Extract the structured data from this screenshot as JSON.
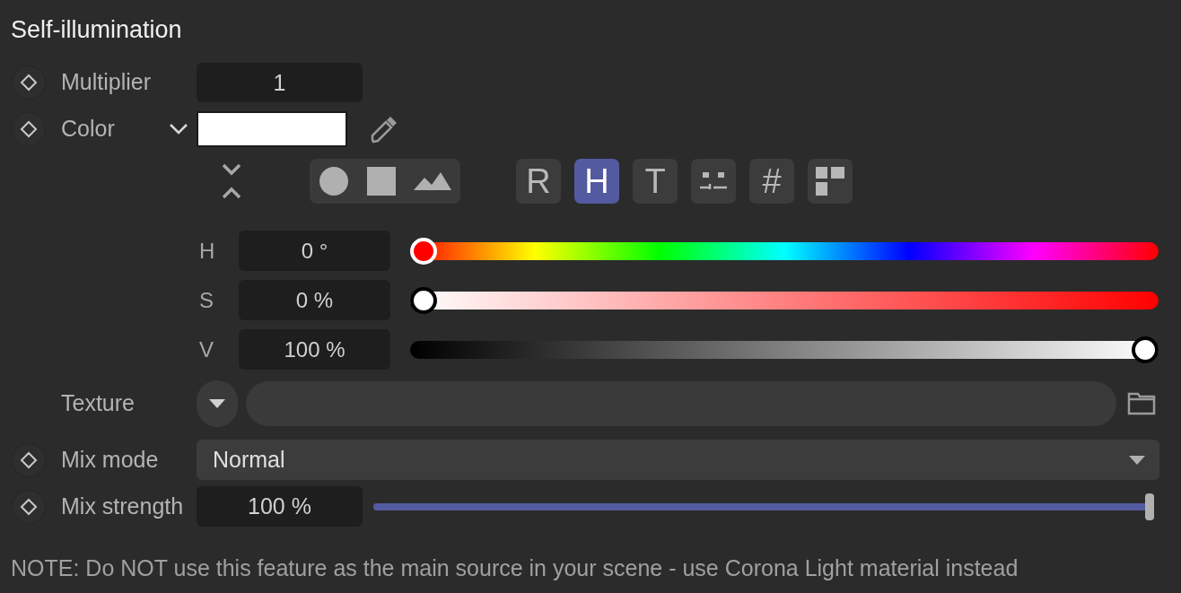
{
  "title": "Self-illumination",
  "multiplier": {
    "label": "Multiplier",
    "value": "1",
    "animatable": true
  },
  "color": {
    "label": "Color",
    "animatable": true
  },
  "shape_modes": [
    {
      "kind": "circle",
      "selected": false
    },
    {
      "kind": "square",
      "selected": false
    },
    {
      "kind": "image",
      "selected": false
    }
  ],
  "model_modes": [
    {
      "kind": "letter",
      "label": "R",
      "selected": false
    },
    {
      "kind": "letter",
      "label": "H",
      "selected": true
    },
    {
      "kind": "letter",
      "label": "T",
      "selected": false
    },
    {
      "kind": "mixer",
      "selected": false
    },
    {
      "kind": "letter",
      "label": "#",
      "selected": false
    },
    {
      "kind": "swatches",
      "selected": false
    }
  ],
  "channels": [
    {
      "kind": "hue",
      "label": "H",
      "value": "0 °",
      "level": 0
    },
    {
      "kind": "saturation",
      "label": "S",
      "value": "0 %",
      "level": 0
    },
    {
      "kind": "value",
      "label": "V",
      "value": "100 %",
      "level": 1
    }
  ],
  "texture": {
    "label": "Texture",
    "animatable": false
  },
  "mix_mode": {
    "label": "Mix mode",
    "value": "Normal",
    "animatable": true
  },
  "mix_strength": {
    "label": "Mix strength",
    "value": "100 %",
    "level": 1,
    "animatable": true
  },
  "note": "NOTE: Do NOT use this feature as the main source in your scene - use Corona Light material instead"
}
